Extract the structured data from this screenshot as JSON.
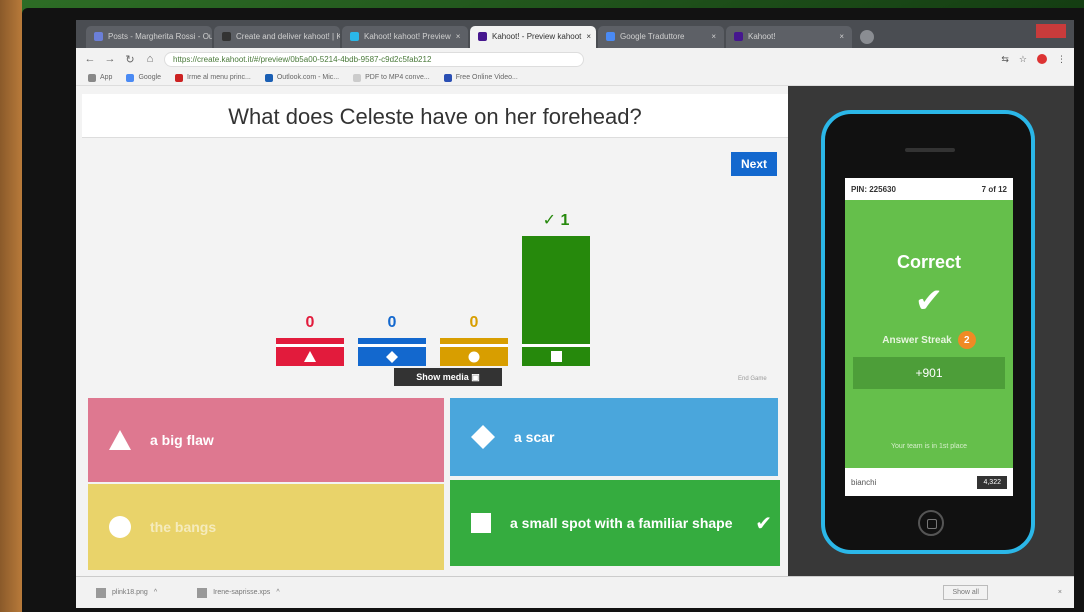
{
  "browser": {
    "tabs": [
      {
        "label": "Posts - Margherita Rossi - Outlo"
      },
      {
        "label": "Create and deliver kahoot! | Kahoo"
      },
      {
        "label": "Kahoot! kahoot! Preview"
      },
      {
        "label": "Kahoot! - Preview kahoot"
      },
      {
        "label": "Google Traduttore"
      },
      {
        "label": "Kahoot!"
      }
    ],
    "active_tab": 3,
    "url": "https://create.kahoot.it/#/preview/0b5a00-5214-4bdb-9587-c9d2c5fab212",
    "bookmarks": [
      "App",
      "Google",
      "Irme al menu princ...",
      "Outlook.com - Mic...",
      "PDF to MP4 conve...",
      "Free Online Video..."
    ]
  },
  "question": {
    "text": "What does Celeste have on her forehead?"
  },
  "controls": {
    "next_label": "Next",
    "show_media_label": "Show media",
    "end_game_label": "End Game"
  },
  "chart_data": {
    "type": "bar",
    "categories": [
      "triangle",
      "diamond",
      "circle",
      "square"
    ],
    "values": [
      0,
      0,
      0,
      1
    ],
    "correct": [
      false,
      false,
      false,
      true
    ],
    "colors": [
      "#e21b3c",
      "#1368ce",
      "#d89e00",
      "#26890c"
    ],
    "count_colors": [
      "#e21b3c",
      "#1368ce",
      "#d89e00",
      "#26890c"
    ],
    "labels": [
      "0",
      "0",
      "0",
      "1"
    ],
    "check_label": "✓"
  },
  "answers": [
    {
      "shape": "triangle",
      "text": "a big flaw",
      "correct": false
    },
    {
      "shape": "diamond",
      "text": "a scar",
      "correct": false
    },
    {
      "shape": "circle",
      "text": "the bangs",
      "correct": false
    },
    {
      "shape": "square",
      "text": "a small spot with a familiar shape",
      "correct": true
    }
  ],
  "phone": {
    "pin": "PIN: 225630",
    "progress": "7 of 12",
    "result": "Correct",
    "streak_label": "Answer Streak",
    "streak_count": "2",
    "points": "+901",
    "place": "Your team is in 1st place",
    "player": "bianchi",
    "score": "4,322"
  },
  "downloads": {
    "items": [
      "plink18.png",
      "Irene-saprisse.xps"
    ],
    "show_all": "Show all"
  }
}
